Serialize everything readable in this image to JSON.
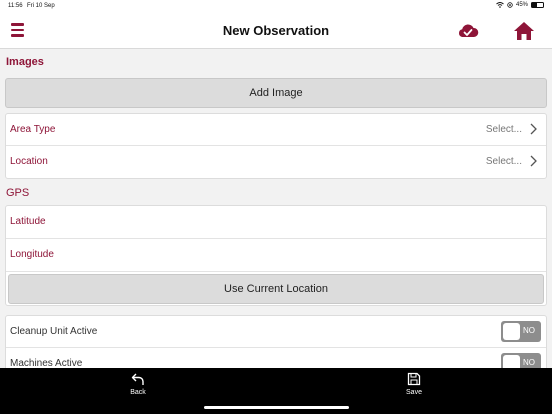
{
  "status_bar": {
    "time": "11:56",
    "date": "Fri 10 Sep",
    "battery": "45%",
    "battery_level": 0.45
  },
  "nav": {
    "title": "New Observation",
    "menu_icon": "hamburger-menu-icon",
    "sync_icon": "cloud-check-icon",
    "home_icon": "home-icon"
  },
  "accent_color": "#8e1538",
  "images": {
    "header": "Images",
    "add_button": "Add Image"
  },
  "classification": {
    "area_type": {
      "label": "Area Type",
      "value": "Select..."
    },
    "location": {
      "label": "Location",
      "value": "Select..."
    }
  },
  "gps": {
    "header": "GPS",
    "latitude_label": "Latitude",
    "longitude_label": "Longitude",
    "use_location_button": "Use Current Location"
  },
  "toggles": [
    {
      "label": "Cleanup Unit Active",
      "state": "NO"
    },
    {
      "label": "Machines Active",
      "state": "NO"
    }
  ],
  "tab_bar": {
    "back_label": "Back",
    "save_label": "Save"
  }
}
